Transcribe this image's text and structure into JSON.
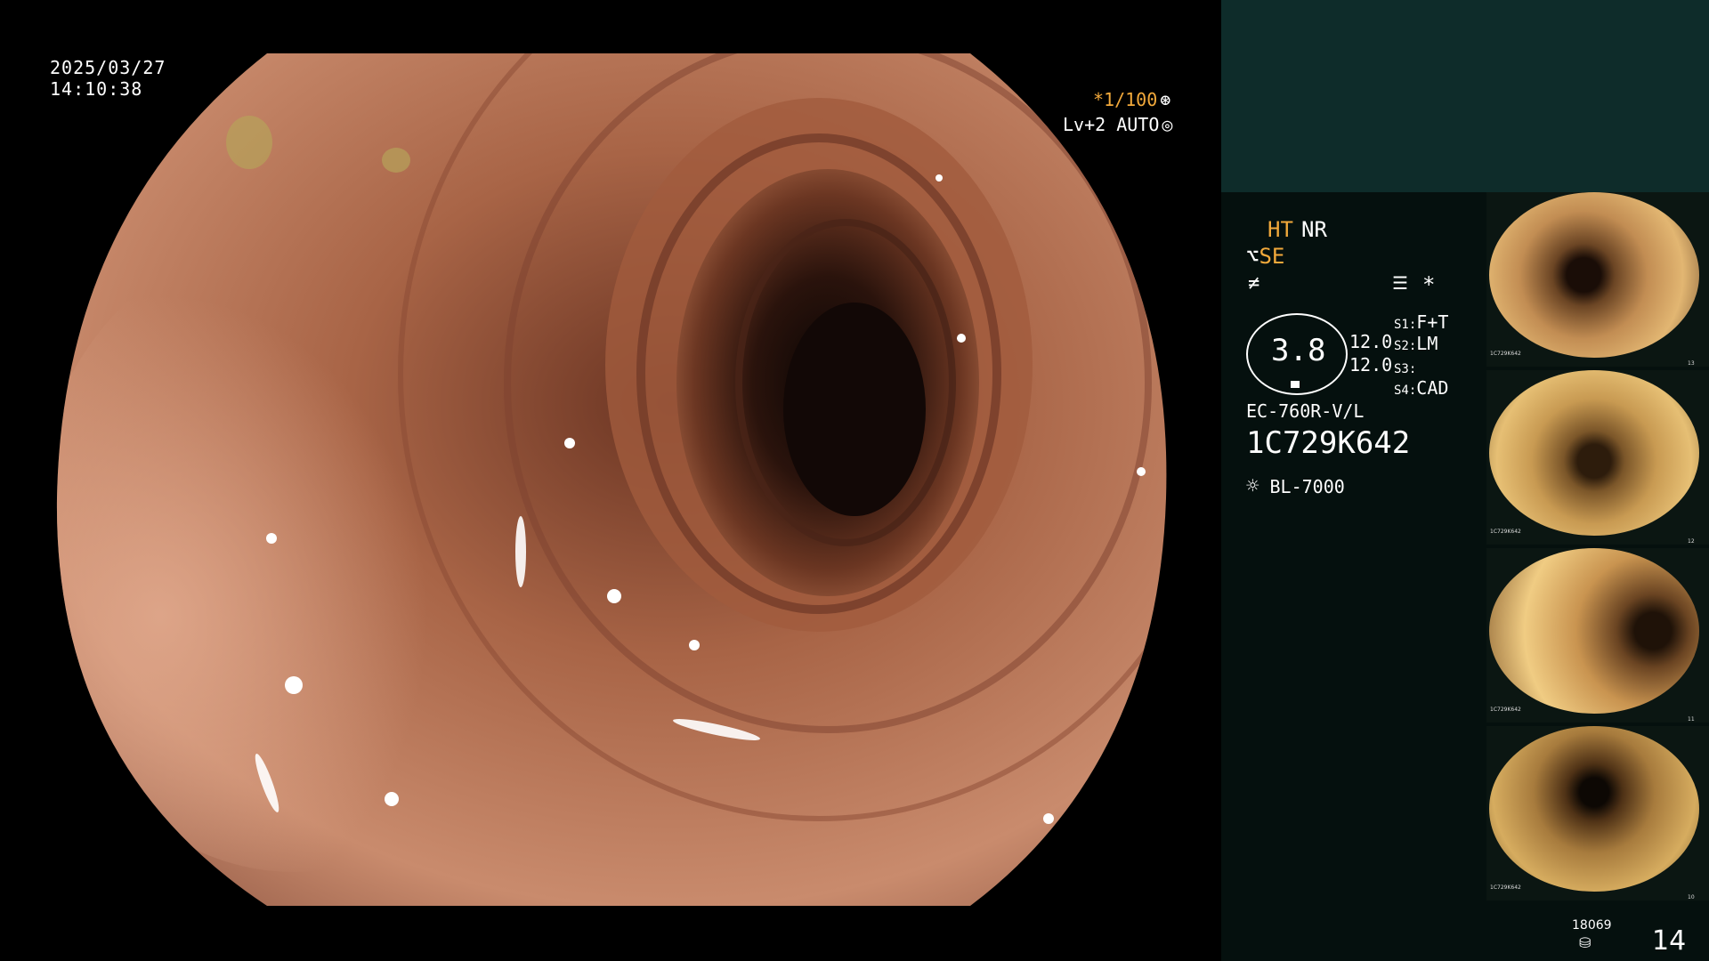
{
  "datetime": {
    "date": "2025/03/27",
    "time": "14:10:38"
  },
  "overlay": {
    "shutter": "*1/100",
    "shutter_icon": "aperture-icon",
    "level": "Lv+2 AUTO",
    "level_icon": "iris-icon"
  },
  "settings": {
    "ht": "HT",
    "nr": "NR",
    "se": "SE",
    "se_icon": "scope-tip-icon",
    "wave_icon": "not-equal-icon",
    "menu_icon": "settings-list-icon",
    "star": "*",
    "gauge_value": "3.8",
    "gauge_sub_1": "12.0",
    "gauge_sub_2": "12.0",
    "s_labels": [
      "S1:",
      "S2:",
      "S3:",
      "S4:"
    ],
    "s_values": [
      "F+T",
      "LM",
      "",
      "CAD"
    ]
  },
  "device": {
    "model": "EC-760R-V/L",
    "serial": "1C729K642",
    "light_source": "BL-7000",
    "light_icon": "lamp-icon"
  },
  "footer": {
    "count": "18069",
    "count_icon": "storage-icon",
    "page": "14"
  },
  "thumbnails": [
    {
      "caption": "1C729K642",
      "num": "13"
    },
    {
      "caption": "1C729K642",
      "num": "12"
    },
    {
      "caption": "1C729K642",
      "num": "11"
    },
    {
      "caption": "1C729K642",
      "num": "10"
    }
  ],
  "colors": {
    "accent_yellow": "#f2a93b",
    "panel_bg": "#05100e",
    "header_teal": "#0e2c2a"
  }
}
